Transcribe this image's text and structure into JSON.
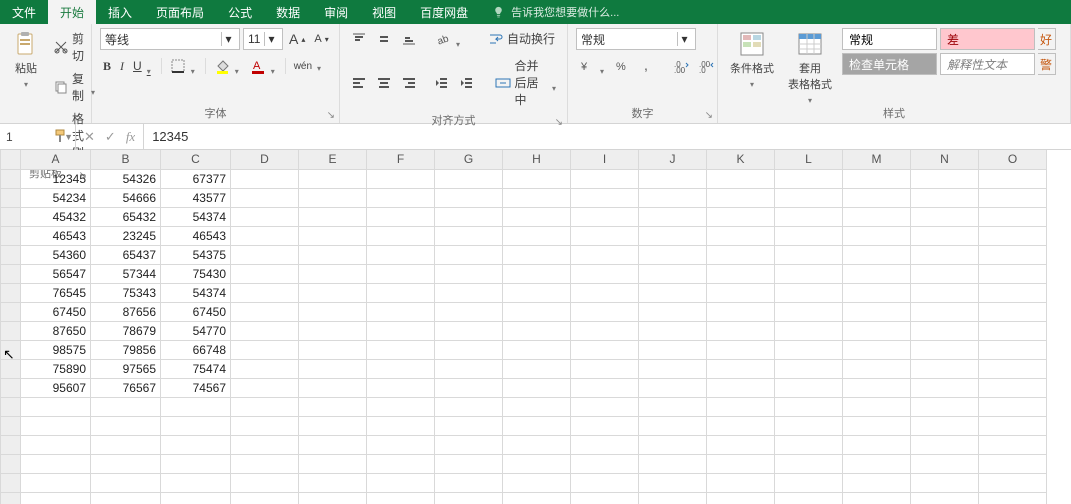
{
  "tabs": {
    "file": "文件",
    "home": "开始",
    "insert": "插入",
    "layout": "页面布局",
    "formulas": "公式",
    "data": "数据",
    "review": "审阅",
    "view": "视图",
    "baidu": "百度网盘",
    "tellme_icon": "lightbulb",
    "tellme": "告诉我您想要做什么..."
  },
  "clipboard": {
    "paste": "粘贴",
    "cut": "剪切",
    "copy": "复制",
    "painter": "格式刷",
    "label": "剪贴板"
  },
  "font": {
    "name": "等线",
    "size": "11",
    "increase": "A",
    "decrease": "A",
    "bold": "B",
    "italic": "I",
    "underline": "U",
    "phonetic": "wén",
    "label": "字体"
  },
  "alignment": {
    "wrap": "自动换行",
    "merge": "合并后居中",
    "label": "对齐方式"
  },
  "number": {
    "format": "常规",
    "label": "数字"
  },
  "styles": {
    "condfmt": "条件格式",
    "tablefmt": "套用\n表格格式",
    "normal": "常规",
    "bad": "差",
    "good": "好",
    "check": "检查单元格",
    "explan": "解释性文本",
    "warn": "警",
    "label": "样式"
  },
  "formula_bar": {
    "namebox": "1",
    "fx": "fx",
    "value": "12345"
  },
  "grid": {
    "columns": [
      "A",
      "B",
      "C",
      "D",
      "E",
      "F",
      "G",
      "H",
      "I",
      "J",
      "K",
      "L",
      "M",
      "N",
      "O"
    ],
    "rows": [
      {
        "A": "12345",
        "B": "54326",
        "C": "67377"
      },
      {
        "A": "54234",
        "B": "54666",
        "C": "43577"
      },
      {
        "A": "45432",
        "B": "65432",
        "C": "54374"
      },
      {
        "A": "46543",
        "B": "23245",
        "C": "46543"
      },
      {
        "A": "54360",
        "B": "65437",
        "C": "54375"
      },
      {
        "A": "56547",
        "B": "57344",
        "C": "75430"
      },
      {
        "A": "76545",
        "B": "75343",
        "C": "54374"
      },
      {
        "A": "67450",
        "B": "87656",
        "C": "67450"
      },
      {
        "A": "87650",
        "B": "78679",
        "C": "54770"
      },
      {
        "A": "98575",
        "B": "79856",
        "C": "66748"
      },
      {
        "A": "75890",
        "B": "97565",
        "C": "75474"
      },
      {
        "A": "95607",
        "B": "76567",
        "C": "74567"
      }
    ],
    "blank_rows": 6
  }
}
